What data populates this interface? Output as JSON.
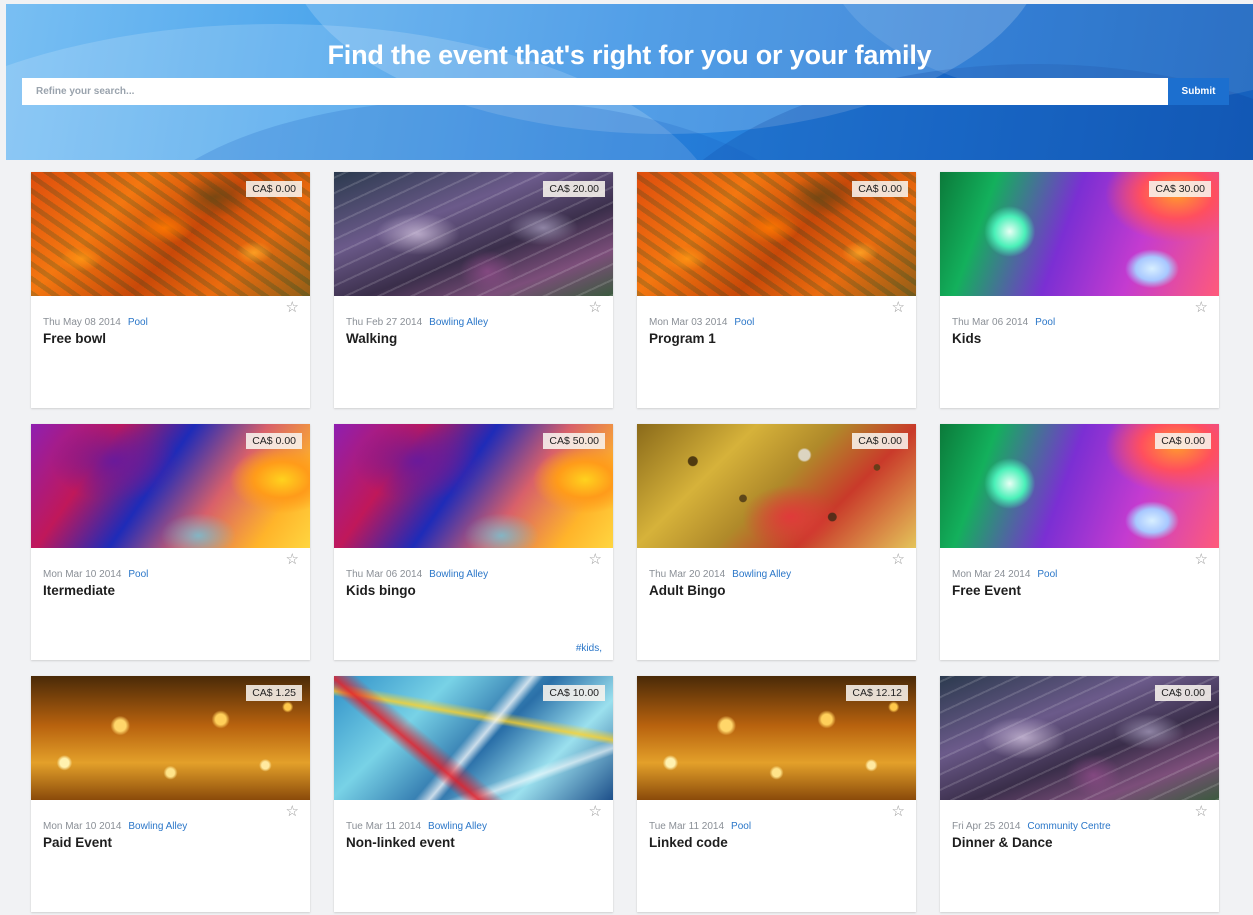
{
  "header": {
    "title": "Find the event that's right for you or your family",
    "search_placeholder": "Refine your search...",
    "search_value": "",
    "submit_label": "Submit",
    "colors": {
      "hero_blue": "#2d8ae2",
      "submit": "#1c6fcf",
      "link": "#2a76c8"
    }
  },
  "events": [
    {
      "price": "CA$ 0.00",
      "date": "Thu May 08 2014",
      "venue": "Pool",
      "title": "Free bowl",
      "image": "autumn",
      "tag": ""
    },
    {
      "price": "CA$ 20.00",
      "date": "Thu Feb 27 2014",
      "venue": "Bowling Alley",
      "title": "Walking",
      "image": "abstract",
      "tag": ""
    },
    {
      "price": "CA$ 0.00",
      "date": "Mon Mar 03 2014",
      "venue": "Pool",
      "title": "Program 1",
      "image": "autumn",
      "tag": ""
    },
    {
      "price": "CA$ 30.00",
      "date": "Thu Mar 06 2014",
      "venue": "Pool",
      "title": "Kids",
      "image": "neon",
      "tag": ""
    },
    {
      "price": "CA$ 0.00",
      "date": "Mon Mar 10 2014",
      "venue": "Pool",
      "title": "Itermediate",
      "image": "blur",
      "tag": ""
    },
    {
      "price": "CA$ 50.00",
      "date": "Thu Mar 06 2014",
      "venue": "Bowling Alley",
      "title": "Kids bingo",
      "image": "blur",
      "tag": "#kids,"
    },
    {
      "price": "CA$ 0.00",
      "date": "Thu Mar 20 2014",
      "venue": "Bowling Alley",
      "title": "Adult Bingo",
      "image": "bubbles",
      "tag": ""
    },
    {
      "price": "CA$ 0.00",
      "date": "Mon Mar 24 2014",
      "venue": "Pool",
      "title": "Free Event",
      "image": "neon",
      "tag": ""
    },
    {
      "price": "CA$ 1.25",
      "date": "Mon Mar 10 2014",
      "venue": "Bowling Alley",
      "title": "Paid Event",
      "image": "bokeh",
      "tag": ""
    },
    {
      "price": "CA$ 10.00",
      "date": "Tue Mar 11 2014",
      "venue": "Bowling Alley",
      "title": "Non-linked event",
      "image": "paint",
      "tag": ""
    },
    {
      "price": "CA$ 12.12",
      "date": "Tue Mar 11 2014",
      "venue": "Pool",
      "title": "Linked code",
      "image": "bokeh",
      "tag": ""
    },
    {
      "price": "CA$ 0.00",
      "date": "Fri Apr 25 2014",
      "venue": "Community Centre",
      "title": "Dinner & Dance",
      "image": "abstract",
      "tag": ""
    }
  ],
  "icons": {
    "favorite": "star-outline-icon"
  }
}
